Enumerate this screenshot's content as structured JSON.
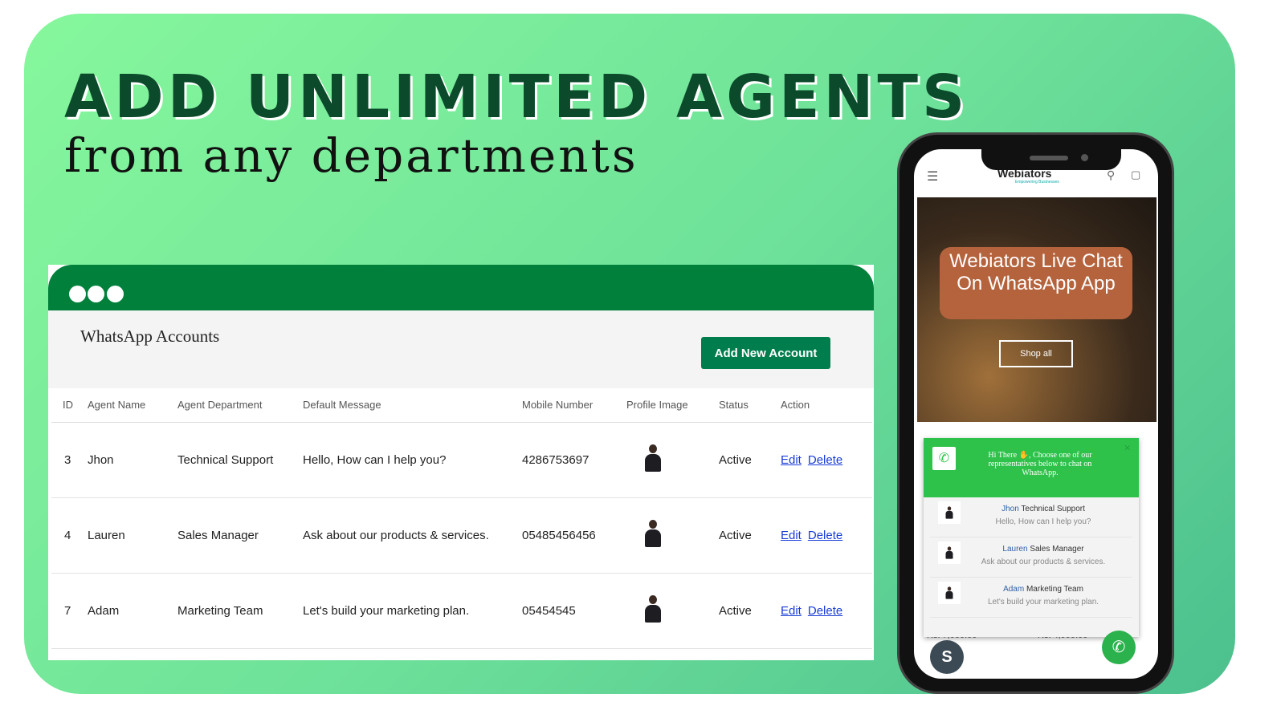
{
  "headline": "ADD UNLIMITED AGENTS",
  "subheadline": "from any departments",
  "admin": {
    "title": "WhatsApp Accounts",
    "add_button": "Add New Account",
    "columns": [
      "ID",
      "Agent Name",
      "Agent Department",
      "Default Message",
      "Mobile Number",
      "Profile Image",
      "Status",
      "Action"
    ],
    "rows": [
      {
        "id": "3",
        "name": "Jhon",
        "dept": "Technical Support",
        "msg": "Hello, How can I help you?",
        "mobile": "4286753697",
        "status": "Active",
        "edit": "Edit",
        "delete": "Delete"
      },
      {
        "id": "4",
        "name": "Lauren",
        "dept": "Sales Manager",
        "msg": "Ask about our products & services.",
        "mobile": "05485456456",
        "status": "Active",
        "edit": "Edit",
        "delete": "Delete"
      },
      {
        "id": "7",
        "name": "Adam",
        "dept": "Marketing Team",
        "msg": "Let's build your marketing plan.",
        "mobile": "05454545",
        "status": "Active",
        "edit": "Edit",
        "delete": "Delete"
      }
    ]
  },
  "phone": {
    "logo": "Webiators",
    "tagline": "Empowering Businesses",
    "hero_title": "Webiators Live Chat On WhatsApp App",
    "shop_all": "Shop all",
    "popup": {
      "greeting": "Hi There ✋, Choose one of our representatives below to chat on WhatsApp.",
      "close": "×",
      "reps": [
        {
          "name": "Jhon",
          "dept": "Technical Support",
          "msg": "Hello, How can I help you?"
        },
        {
          "name": "Lauren",
          "dept": "Sales Manager",
          "msg": "Ask about our products & services."
        },
        {
          "name": "Adam",
          "dept": "Marketing Team",
          "msg": "Let's build your marketing plan."
        }
      ]
    },
    "prices": [
      "Rs. 7,000.00",
      "Rs. 4,999.00"
    ]
  },
  "colors": {
    "window_bar": "#00803a",
    "button": "#007d4c",
    "popup_header": "#2ec24a"
  }
}
